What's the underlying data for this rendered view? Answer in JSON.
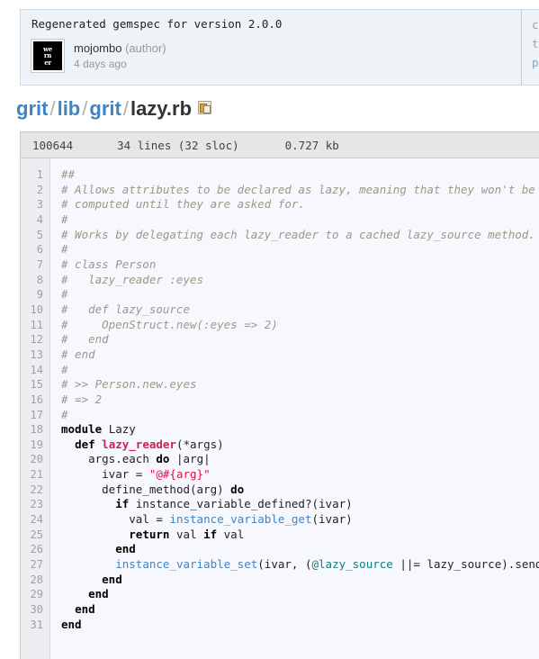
{
  "commit": {
    "message": "Regenerated gemspec for version 2.0.0",
    "author": "mojombo",
    "author_role": "(author)",
    "date": "4 days ago",
    "avatar_lines": [
      "we",
      "rn",
      "er"
    ],
    "avatar_alt": "werner",
    "sidebar_truncated": [
      "cc",
      "tr",
      "pc"
    ]
  },
  "breadcrumb": {
    "repo": "grit",
    "sep": "/",
    "dir1": "lib",
    "dir2": "grit",
    "file": "lazy.rb",
    "copy_icon": "copy-to-clipboard-icon"
  },
  "file_meta": {
    "mode": "100644",
    "lines": "34 lines (32 sloc)",
    "size": "0.727 kb"
  },
  "code": {
    "line_numbers": [
      1,
      2,
      3,
      4,
      5,
      6,
      7,
      8,
      9,
      10,
      11,
      12,
      13,
      14,
      15,
      16,
      17,
      18,
      19,
      20,
      21,
      22,
      23,
      24,
      25,
      26,
      27,
      28,
      29,
      30,
      31
    ],
    "lines": [
      "##",
      "# Allows attributes to be declared as lazy, meaning that they won't be",
      "# computed until they are asked for.",
      "#",
      "# Works by delegating each lazy_reader to a cached lazy_source method.",
      "#",
      "# class Person",
      "#   lazy_reader :eyes",
      "#",
      "#   def lazy_source",
      "#     OpenStruct.new(:eyes => 2)",
      "#   end",
      "# end",
      "#",
      "# >> Person.new.eyes",
      "# => 2",
      "#",
      "module Lazy",
      "  def lazy_reader(*args)",
      "    args.each do |arg|",
      "      ivar = \"@#{arg}\"",
      "      define_method(arg) do",
      "        if instance_variable_defined?(ivar)",
      "          val = instance_variable_get(ivar)",
      "          return val if val",
      "        end",
      "        instance_variable_set(ivar, (@lazy_source ||= lazy_source).send(arg))",
      "      end",
      "    end",
      "  end",
      "end"
    ]
  },
  "colors": {
    "link": "#4183c4",
    "comment": "#999988",
    "keyword": "#000000",
    "function": "#c7254e",
    "string": "#dd1144",
    "ivar": "#108080",
    "code_bg": "#f7f8fd",
    "gutter_bg": "#eceef2",
    "commit_bg": "#eef3f8",
    "meta_bg": "#e6e6e6"
  }
}
